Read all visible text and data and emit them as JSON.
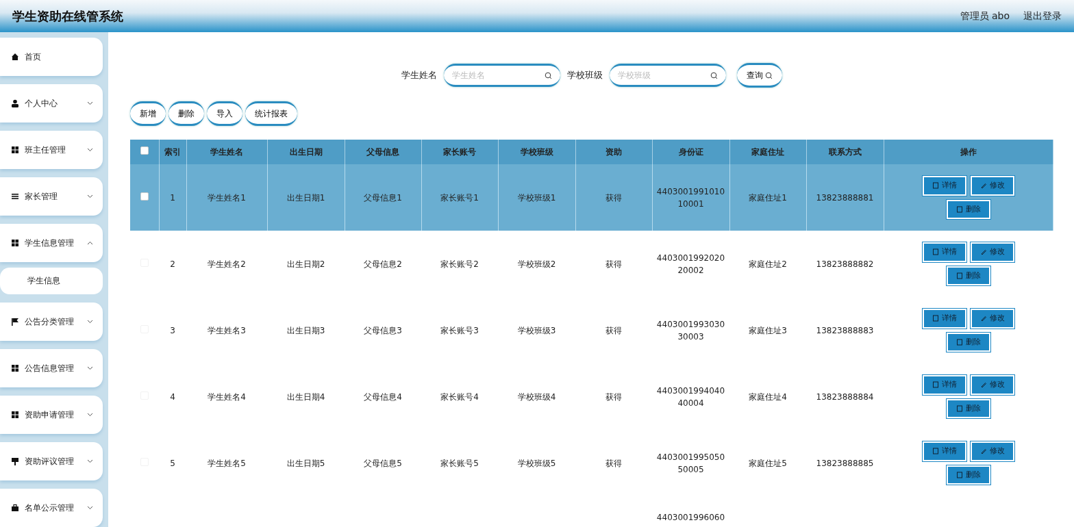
{
  "header": {
    "title": "学生资助在线管系统",
    "user": "管理员 abo",
    "logout": "退出登录"
  },
  "sidebar": {
    "items": [
      {
        "label": "首页",
        "expanded": false,
        "has_arrow": false
      },
      {
        "label": "个人中心",
        "expanded": false,
        "has_arrow": true
      },
      {
        "label": "班主任管理",
        "expanded": false,
        "has_arrow": true
      },
      {
        "label": "家长管理",
        "expanded": false,
        "has_arrow": true
      },
      {
        "label": "学生信息管理",
        "expanded": true,
        "has_arrow": true,
        "children": [
          {
            "label": "学生信息"
          }
        ]
      },
      {
        "label": "公告分类管理",
        "expanded": false,
        "has_arrow": true
      },
      {
        "label": "公告信息管理",
        "expanded": false,
        "has_arrow": true
      },
      {
        "label": "资助申请管理",
        "expanded": false,
        "has_arrow": true
      },
      {
        "label": "资助评议管理",
        "expanded": false,
        "has_arrow": true
      },
      {
        "label": "名单公示管理",
        "expanded": false,
        "has_arrow": true
      }
    ]
  },
  "search": {
    "fields": [
      {
        "label": "学生姓名",
        "placeholder": "学生姓名"
      },
      {
        "label": "学校班级",
        "placeholder": "学校班级"
      }
    ],
    "button": "查询"
  },
  "toolbar": [
    "新增",
    "删除",
    "导入",
    "统计报表"
  ],
  "table": {
    "select_all_checked": false,
    "columns": [
      "索引",
      "学生姓名",
      "出生日期",
      "父母信息",
      "家长账号",
      "学校班级",
      "资助",
      "身份证",
      "家庭住址",
      "联系方式",
      "操作"
    ],
    "rows": [
      {
        "selected": true,
        "cells": [
          "1",
          "学生姓名1",
          "出生日期1",
          "父母信息1",
          "家长账号1",
          "学校班级1",
          "获得",
          "440300199101010001",
          "家庭住址1",
          "13823888881"
        ],
        "actions": [
          "详情",
          "修改",
          "删除"
        ]
      },
      {
        "selected": false,
        "cells": [
          "2",
          "学生姓名2",
          "出生日期2",
          "父母信息2",
          "家长账号2",
          "学校班级2",
          "获得",
          "440300199202020002",
          "家庭住址2",
          "13823888882"
        ],
        "actions": [
          "详情",
          "修改",
          "删除"
        ]
      },
      {
        "selected": false,
        "cells": [
          "3",
          "学生姓名3",
          "出生日期3",
          "父母信息3",
          "家长账号3",
          "学校班级3",
          "获得",
          "440300199303030003",
          "家庭住址3",
          "13823888883"
        ],
        "actions": [
          "详情",
          "修改",
          "删除"
        ]
      },
      {
        "selected": false,
        "cells": [
          "4",
          "学生姓名4",
          "出生日期4",
          "父母信息4",
          "家长账号4",
          "学校班级4",
          "获得",
          "440300199404040004",
          "家庭住址4",
          "13823888884"
        ],
        "actions": [
          "详情",
          "修改",
          "删除"
        ]
      },
      {
        "selected": false,
        "cells": [
          "5",
          "学生姓名5",
          "出生日期5",
          "父母信息5",
          "家长账号5",
          "学校班级5",
          "获得",
          "440300199505050005",
          "家庭住址5",
          "13823888885"
        ],
        "actions": [
          "详情",
          "修改",
          "删除"
        ]
      },
      {
        "selected": false,
        "partial": true,
        "cells": [
          "",
          "",
          "",
          "",
          "",
          "",
          "",
          "4403001996060",
          "",
          ""
        ],
        "actions": []
      }
    ]
  }
}
